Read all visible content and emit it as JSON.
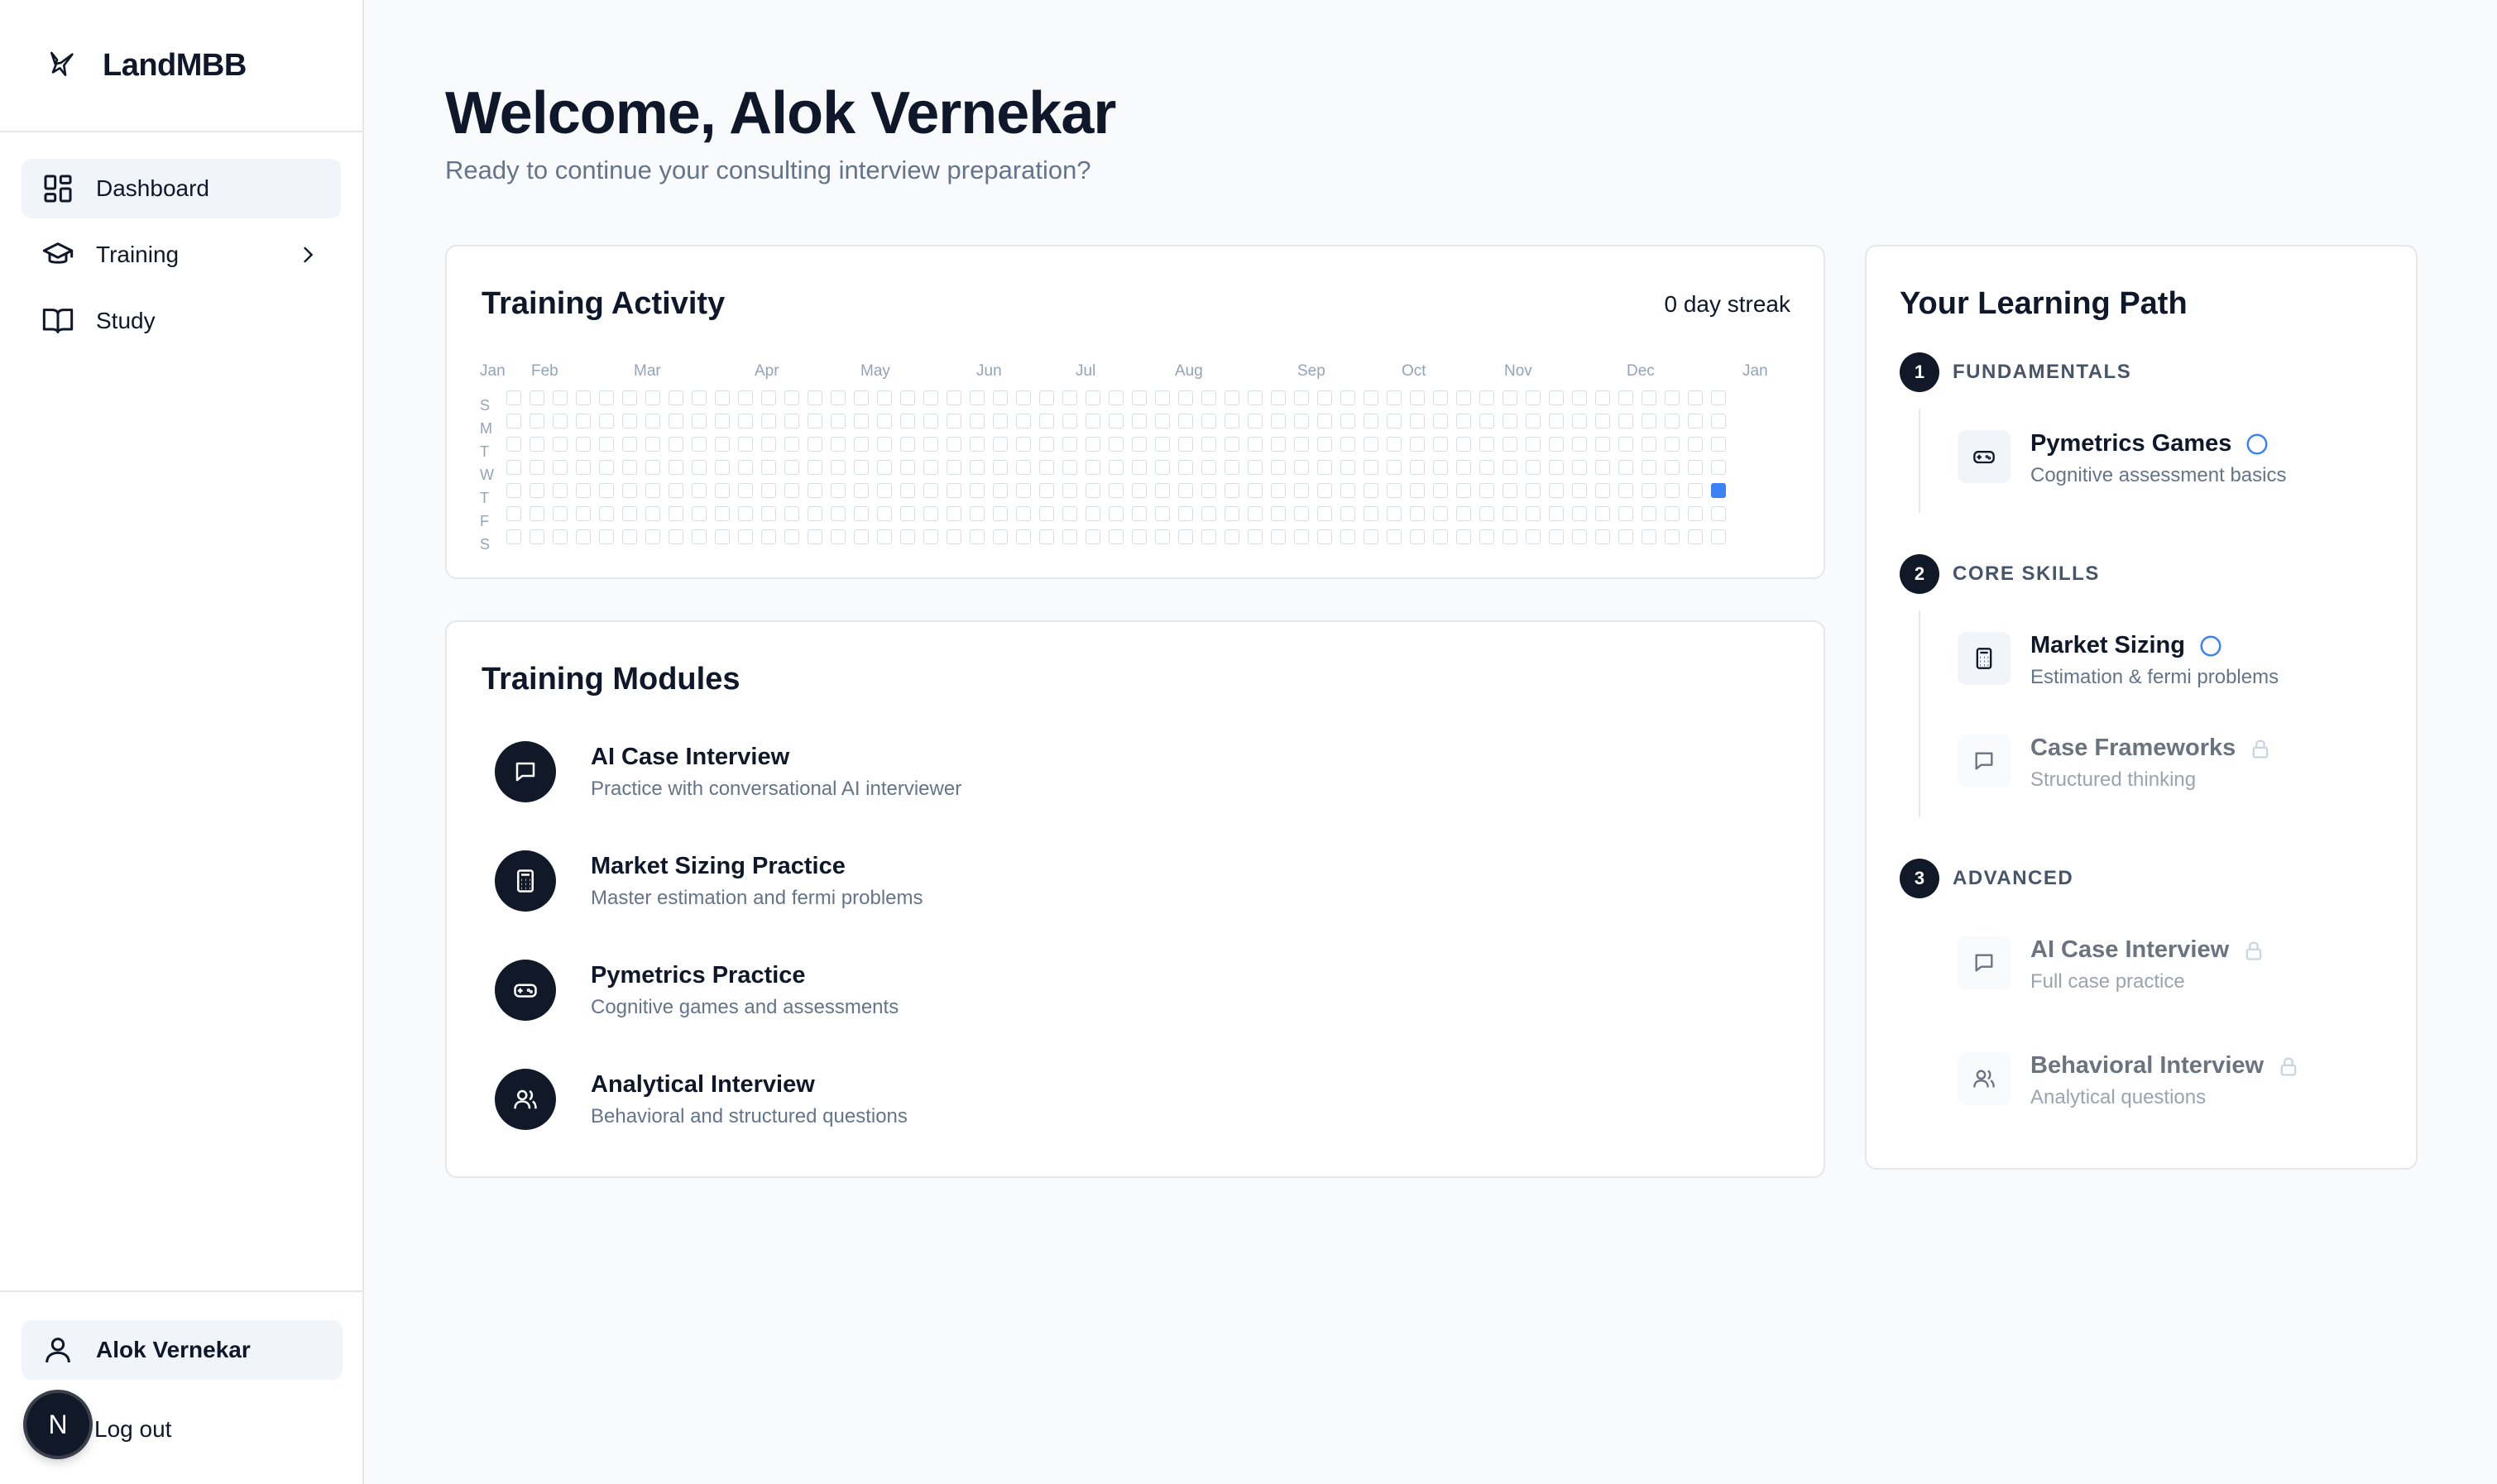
{
  "brand": {
    "name": "LandMBB",
    "logo_icon": "bird-logo-icon"
  },
  "nav": {
    "items": [
      {
        "label": "Dashboard",
        "icon": "dashboard-grid-icon",
        "active": true
      },
      {
        "label": "Training",
        "icon": "graduation-cap-icon",
        "has_submenu": true
      },
      {
        "label": "Study",
        "icon": "book-open-icon"
      }
    ]
  },
  "user": {
    "name": "Alok Vernekar",
    "icon": "user-icon",
    "logout_label": "Log out",
    "badge_letter": "N"
  },
  "header": {
    "title": "Welcome, Alok Vernekar",
    "subtitle": "Ready to continue your consulting interview preparation?"
  },
  "activity": {
    "title": "Training Activity",
    "streak": "0 day streak",
    "months": [
      "Jan",
      "Feb",
      "Mar",
      "Apr",
      "May",
      "Jun",
      "Jul",
      "Aug",
      "Sep",
      "Oct",
      "Nov",
      "Dec",
      "Jan"
    ],
    "weekdays": [
      "S",
      "M",
      "T",
      "W",
      "T",
      "F",
      "S"
    ],
    "weeks": 53,
    "active_cells": [
      {
        "week": 52,
        "day": 4
      }
    ],
    "active_color": "#3b82f6"
  },
  "modules": {
    "title": "Training Modules",
    "items": [
      {
        "title": "AI Case Interview",
        "desc": "Practice with conversational AI interviewer",
        "icon": "chat-bubble-icon"
      },
      {
        "title": "Market Sizing Practice",
        "desc": "Master estimation and fermi problems",
        "icon": "calculator-icon"
      },
      {
        "title": "Pymetrics Practice",
        "desc": "Cognitive games and assessments",
        "icon": "gamepad-icon"
      },
      {
        "title": "Analytical Interview",
        "desc": "Behavioral and structured questions",
        "icon": "users-icon"
      }
    ]
  },
  "learning_path": {
    "title": "Your Learning Path",
    "stages": [
      {
        "number": "1",
        "label": "FUNDAMENTALS",
        "items": [
          {
            "title": "Pymetrics Games",
            "desc": "Cognitive assessment basics",
            "icon": "gamepad-icon",
            "status": "available"
          }
        ]
      },
      {
        "number": "2",
        "label": "CORE SKILLS",
        "items": [
          {
            "title": "Market Sizing",
            "desc": "Estimation & fermi problems",
            "icon": "calculator-icon",
            "status": "available"
          },
          {
            "title": "Case Frameworks",
            "desc": "Structured thinking",
            "icon": "chat-bubble-icon",
            "status": "locked"
          }
        ]
      },
      {
        "number": "3",
        "label": "ADVANCED",
        "items": [
          {
            "title": "AI Case Interview",
            "desc": "Full case practice",
            "icon": "chat-bubble-icon",
            "status": "locked"
          },
          {
            "title": "Behavioral Interview",
            "desc": "Analytical questions",
            "icon": "users-icon",
            "status": "locked"
          }
        ]
      }
    ]
  },
  "colors": {
    "accent": "#3b82f6",
    "dark": "#111827",
    "muted": "#64748b"
  }
}
